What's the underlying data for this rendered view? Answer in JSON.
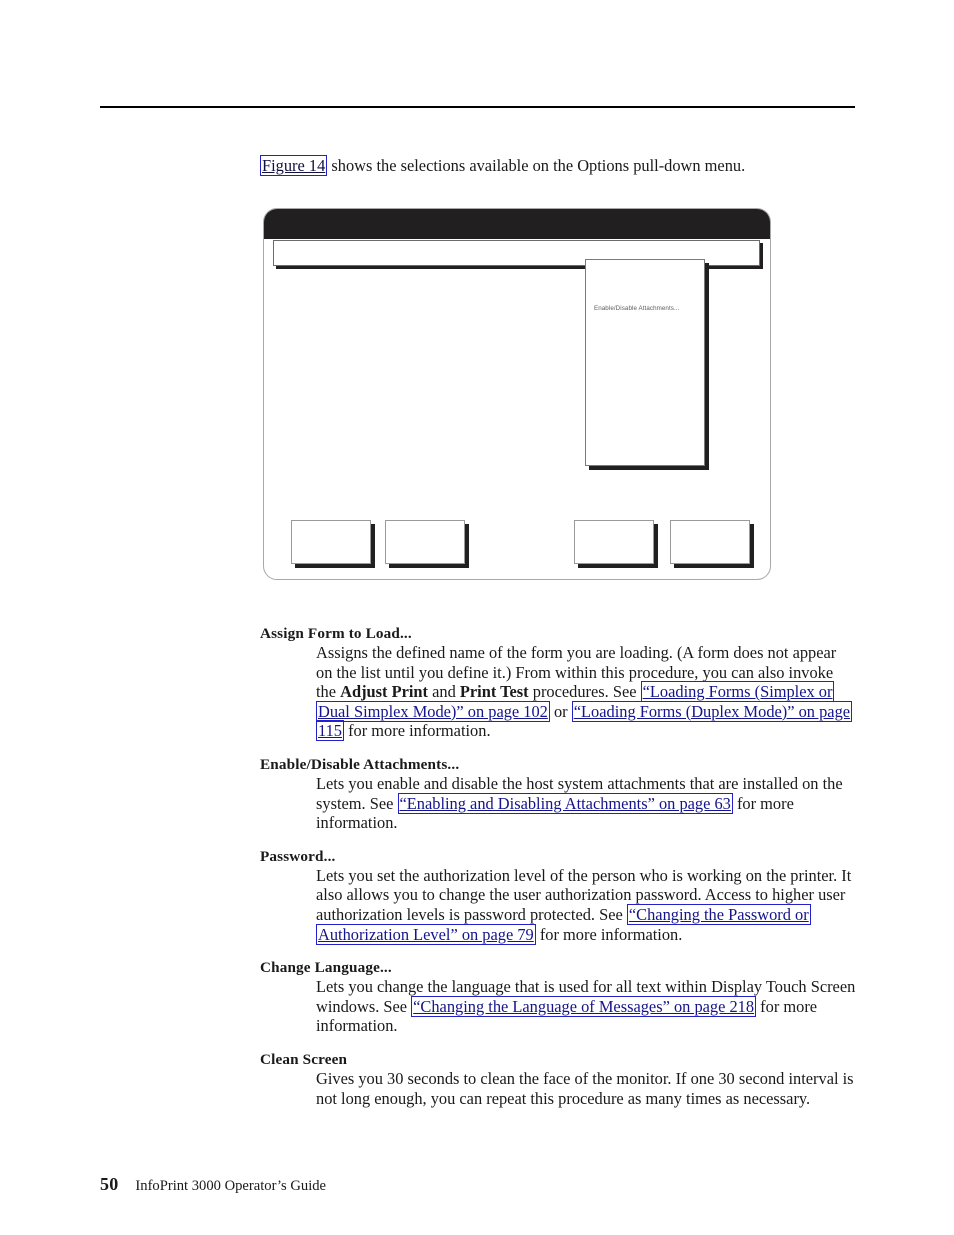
{
  "page": {
    "footer_page_number": "50",
    "footer_title": "InfoPrint 3000 Operator’s Guide"
  },
  "intro": {
    "link_label": "Figure 14",
    "text_after": " shows the selections available on the Options pull-down menu."
  },
  "figure": {
    "name": "Options pull-down menu screen capture",
    "titlebar_label": "",
    "menubar_label": "",
    "colors": {
      "titlebar": "#221f20",
      "shadow": "#221f20",
      "frame_border": "#a8a8a8"
    },
    "dropdown": {
      "items": [
        "Enable/Disable Attachments..."
      ]
    },
    "buttons": [
      {
        "label": ""
      },
      {
        "label": ""
      },
      {
        "label": ""
      },
      {
        "label": ""
      }
    ]
  },
  "definitions": [
    {
      "term": "Assign Form to Load...",
      "body_parts": [
        {
          "type": "text",
          "value": "Assigns the defined name of the form you are loading. (A form does not appear on the list until you define it.) From within this procedure, you can also invoke the "
        },
        {
          "type": "bold",
          "value": "Adjust Print"
        },
        {
          "type": "text",
          "value": " and "
        },
        {
          "type": "bold",
          "value": "Print Test"
        },
        {
          "type": "text",
          "value": " procedures. See "
        },
        {
          "type": "link",
          "value": "“Loading Forms (Simplex or Dual Simplex Mode)” on page 102"
        },
        {
          "type": "text",
          "value": " or "
        },
        {
          "type": "link",
          "value": "“Loading Forms (Duplex Mode)” on page 115"
        },
        {
          "type": "text",
          "value": " for more information."
        }
      ]
    },
    {
      "term": "Enable/Disable Attachments...",
      "body_parts": [
        {
          "type": "text",
          "value": "Lets you enable and disable the host system attachments that are installed on the system. See "
        },
        {
          "type": "link",
          "value": "“Enabling and Disabling Attachments” on page 63"
        },
        {
          "type": "text",
          "value": " for more information."
        }
      ]
    },
    {
      "term": "Password...",
      "body_parts": [
        {
          "type": "text",
          "value": "Lets you set the authorization level of the person who is working on the printer. It also allows you to change the user authorization password. Access to higher user authorization levels is password protected. See "
        },
        {
          "type": "link",
          "value": "“Changing the Password or Authorization Level” on page 79"
        },
        {
          "type": "text",
          "value": " for more information."
        }
      ]
    },
    {
      "term": "Change Language...",
      "body_parts": [
        {
          "type": "text",
          "value": "Lets you change the language that is used for all text within Display Touch Screen windows. See "
        },
        {
          "type": "link",
          "value": "“Changing the Language of Messages” on page 218"
        },
        {
          "type": "text",
          "value": " for more information."
        }
      ]
    },
    {
      "term": "Clean Screen",
      "body_parts": [
        {
          "type": "text",
          "value": "Gives you 30 seconds to clean the face of the monitor. If one 30 second interval is not long enough, you can repeat this procedure as many times as necessary."
        }
      ]
    }
  ]
}
